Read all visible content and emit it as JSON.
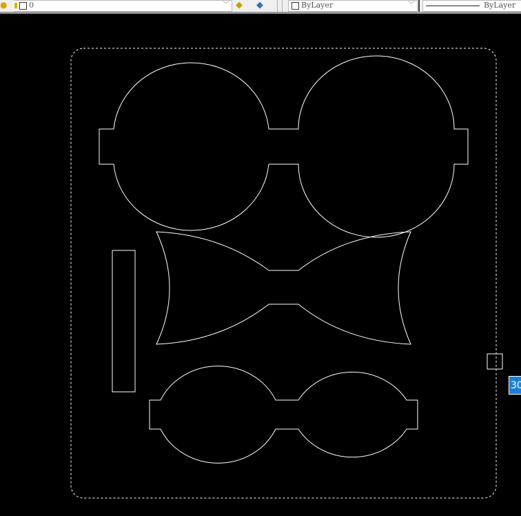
{
  "toolbar": {
    "layer_value": "0",
    "color_value": "ByLayer",
    "linetype_value": "ByLayer"
  },
  "canvas": {
    "dynamic_input_value": "30",
    "line_color": "#ffffff",
    "background": "#000000"
  }
}
